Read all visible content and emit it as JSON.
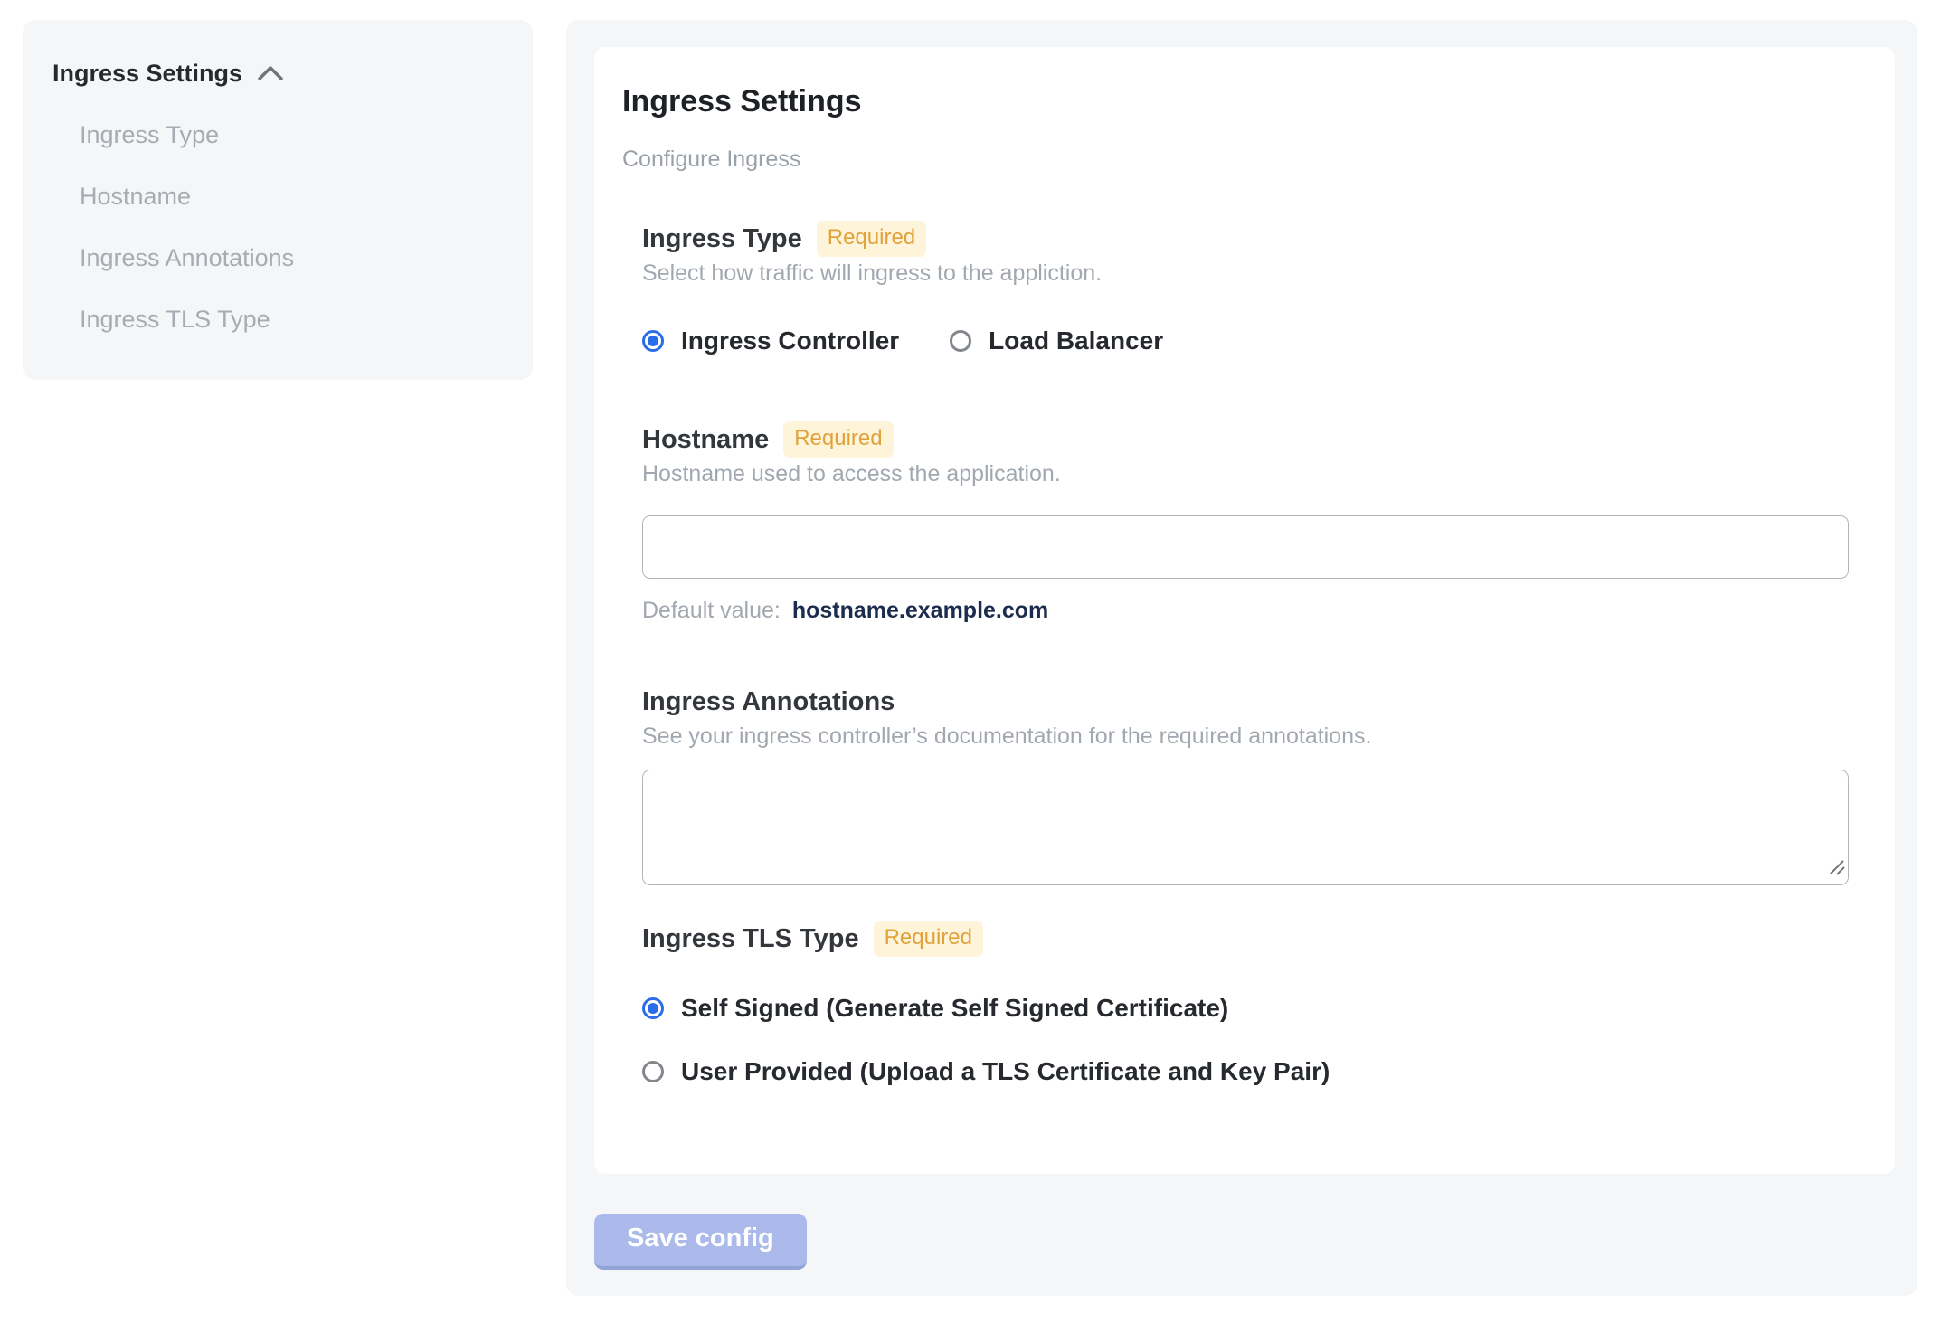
{
  "sidebar": {
    "header": "Ingress Settings",
    "items": [
      {
        "label": "Ingress Type"
      },
      {
        "label": "Hostname"
      },
      {
        "label": "Ingress Annotations"
      },
      {
        "label": "Ingress TLS Type"
      }
    ]
  },
  "main": {
    "title": "Ingress Settings",
    "subtitle": "Configure Ingress",
    "required_badge": "Required",
    "sections": {
      "ingress_type": {
        "label": "Ingress Type",
        "required": true,
        "description": "Select how traffic will ingress to the appliction.",
        "options": [
          {
            "label": "Ingress Controller",
            "selected": true
          },
          {
            "label": "Load Balancer",
            "selected": false
          }
        ]
      },
      "hostname": {
        "label": "Hostname",
        "required": true,
        "description": "Hostname used to access the application.",
        "input_value": "",
        "default_value_label": "Default value:",
        "default_value": "hostname.example.com"
      },
      "ingress_annotations": {
        "label": "Ingress Annotations",
        "required": false,
        "description": "See your ingress controller’s documentation for the required annotations.",
        "textarea_value": ""
      },
      "ingress_tls_type": {
        "label": "Ingress TLS Type",
        "required": true,
        "options": [
          {
            "label": "Self Signed (Generate Self Signed Certificate)",
            "selected": true
          },
          {
            "label": "User Provided (Upload a TLS Certificate and Key Pair)",
            "selected": false
          }
        ]
      }
    },
    "save_button": "Save config"
  },
  "colors": {
    "accent_blue": "#2a6de9",
    "panel_bg": "#f5f6f8",
    "badge_bg": "#fdf4da",
    "badge_text": "#e2a23b",
    "default_value_color": "#1c2c4e",
    "save_button_bg": "#abbaeb",
    "save_button_edge": "#93a3d8"
  }
}
